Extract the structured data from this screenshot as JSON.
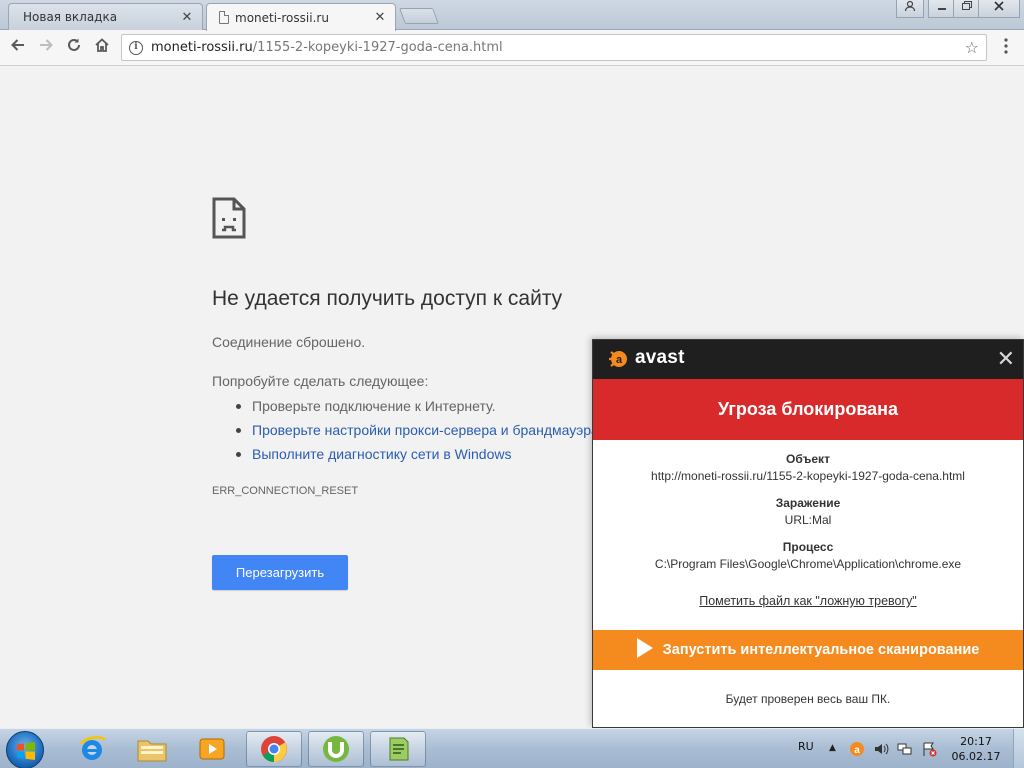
{
  "browser": {
    "tabs": [
      {
        "title": "Новая вкладка",
        "active": false
      },
      {
        "title": "moneti-rossii.ru",
        "active": true
      }
    ],
    "tab_close_glyph": "✕",
    "omnibox": {
      "host": "moneti-rossii.ru",
      "path": "/1155-2-kopeyki-1927-goda-cena.html"
    },
    "icons": {
      "back": "arrow-left-icon",
      "forward": "arrow-right-icon",
      "reload": "reload-icon",
      "home": "home-icon",
      "info": "info-icon",
      "bookmark": "star-icon",
      "menu": "kebab-menu-icon"
    }
  },
  "error_page": {
    "title": "Не удается получить доступ к сайту",
    "subtitle": "Соединение сброшено.",
    "try_heading": "Попробуйте сделать следующее:",
    "suggestions": [
      {
        "text": "Проверьте подключение к Интернету.",
        "link": false
      },
      {
        "text": "Проверьте настройки прокси-сервера и брандмауэра.",
        "link": true
      },
      {
        "text": "Выполните диагностику сети в Windows",
        "link": true
      }
    ],
    "error_code": "ERR_CONNECTION_RESET",
    "reload_label": "Перезагрузить",
    "button_color": "#4285f4"
  },
  "avast": {
    "brand": "avast",
    "close_glyph": "✕",
    "alert_title": "Угроза блокирована",
    "alert_color": "#d82a2b",
    "fields": [
      {
        "label": "Объект",
        "value": "http://moneti-rossii.ru/1155-2-kopeyki-1927-goda-cena.html"
      },
      {
        "label": "Заражение",
        "value": "URL:Mal"
      },
      {
        "label": "Процесс",
        "value": "C:\\Program Files\\Google\\Chrome\\Application\\chrome.exe"
      }
    ],
    "report_link": "Пометить файл как \"ложную тревогу\"",
    "scan_button": "Запустить интеллектуальное сканирование",
    "scan_color": "#f58b1f",
    "footnote": "Будет проверен весь ваш ПК."
  },
  "taskbar": {
    "apps": [
      "ie-icon",
      "explorer-icon",
      "media-player-icon",
      "chrome-icon",
      "utorrent-icon",
      "notepad-icon"
    ],
    "language": "RU",
    "clock_time": "20:17",
    "clock_date": "06.02.17"
  }
}
